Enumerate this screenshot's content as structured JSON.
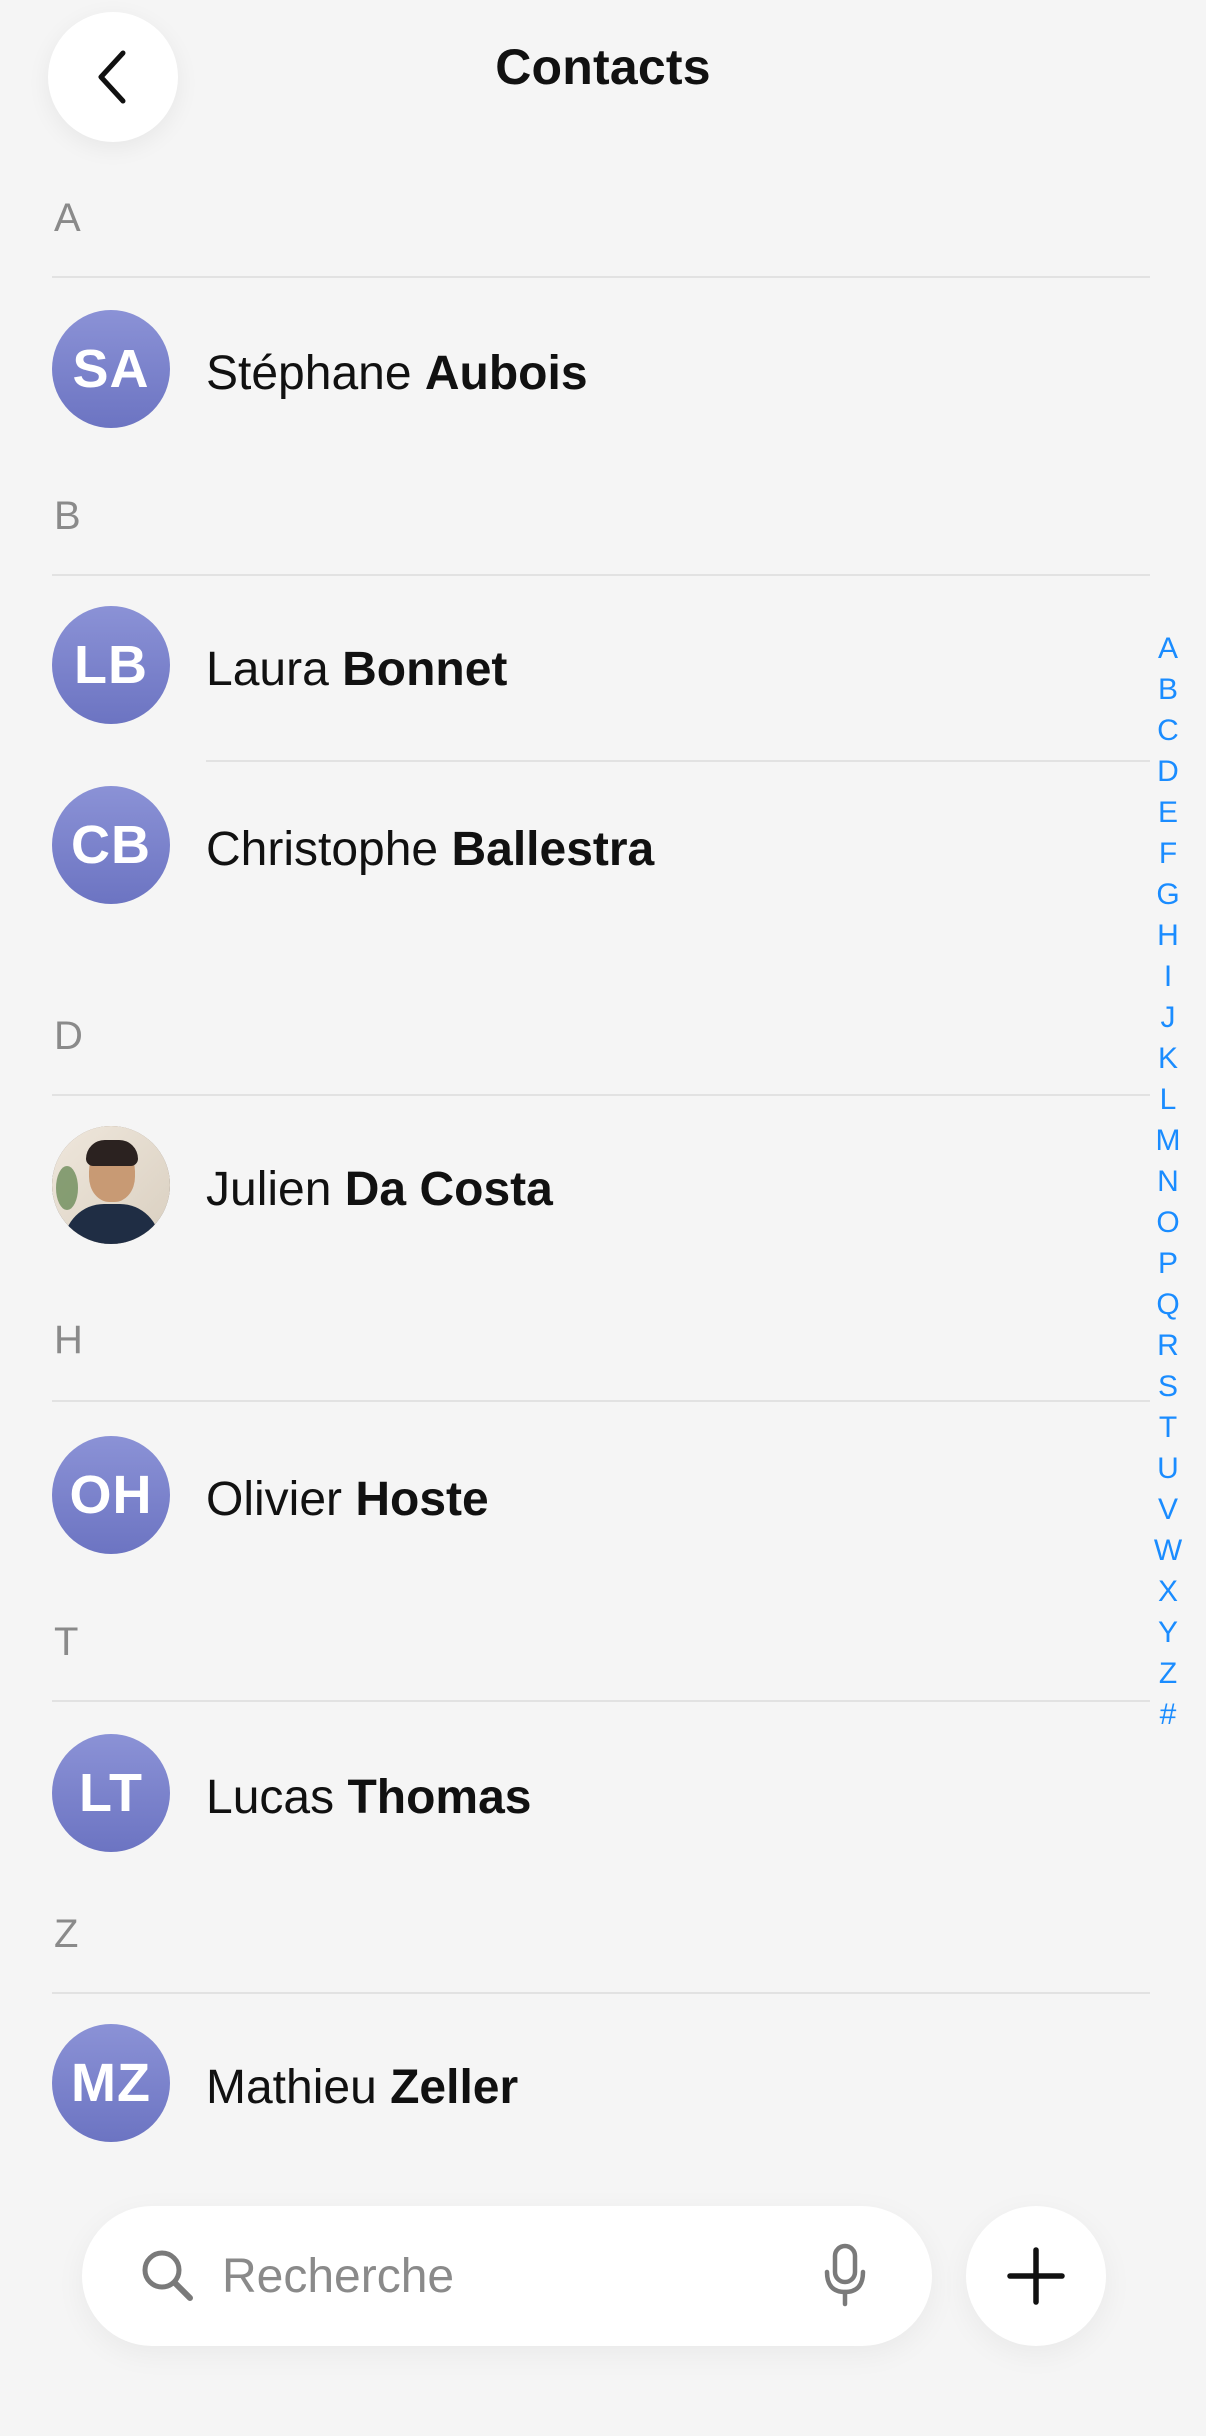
{
  "header": {
    "title": "Contacts"
  },
  "sections": [
    {
      "letter": "A",
      "contacts": [
        {
          "initials": "SA",
          "first": "Stéphane",
          "last": "Aubois"
        }
      ]
    },
    {
      "letter": "B",
      "contacts": [
        {
          "initials": "LB",
          "first": "Laura",
          "last": "Bonnet"
        },
        {
          "initials": "CB",
          "first": "Christophe",
          "last": "Ballestra"
        }
      ]
    },
    {
      "letter": "D",
      "contacts": [
        {
          "initials": "",
          "first": "Julien",
          "last": "Da Costa",
          "has_photo": true
        }
      ]
    },
    {
      "letter": "H",
      "contacts": [
        {
          "initials": "OH",
          "first": "Olivier",
          "last": "Hoste"
        }
      ]
    },
    {
      "letter": "T",
      "contacts": [
        {
          "initials": "LT",
          "first": "Lucas",
          "last": "Thomas"
        }
      ]
    },
    {
      "letter": "Z",
      "contacts": [
        {
          "initials": "MZ",
          "first": "Mathieu",
          "last": "Zeller"
        }
      ]
    }
  ],
  "index_letters": [
    "A",
    "B",
    "C",
    "D",
    "E",
    "F",
    "G",
    "H",
    "I",
    "J",
    "K",
    "L",
    "M",
    "N",
    "O",
    "P",
    "Q",
    "R",
    "S",
    "T",
    "U",
    "V",
    "W",
    "X",
    "Y",
    "Z",
    "#"
  ],
  "search": {
    "placeholder": "Recherche"
  },
  "colors": {
    "accent": "#1a8cff",
    "avatar": "#7a82cc",
    "background": "#f5f5f5"
  },
  "icons": {
    "back": "chevron-left-icon",
    "search": "search-icon",
    "mic": "microphone-icon",
    "add": "plus-icon"
  }
}
